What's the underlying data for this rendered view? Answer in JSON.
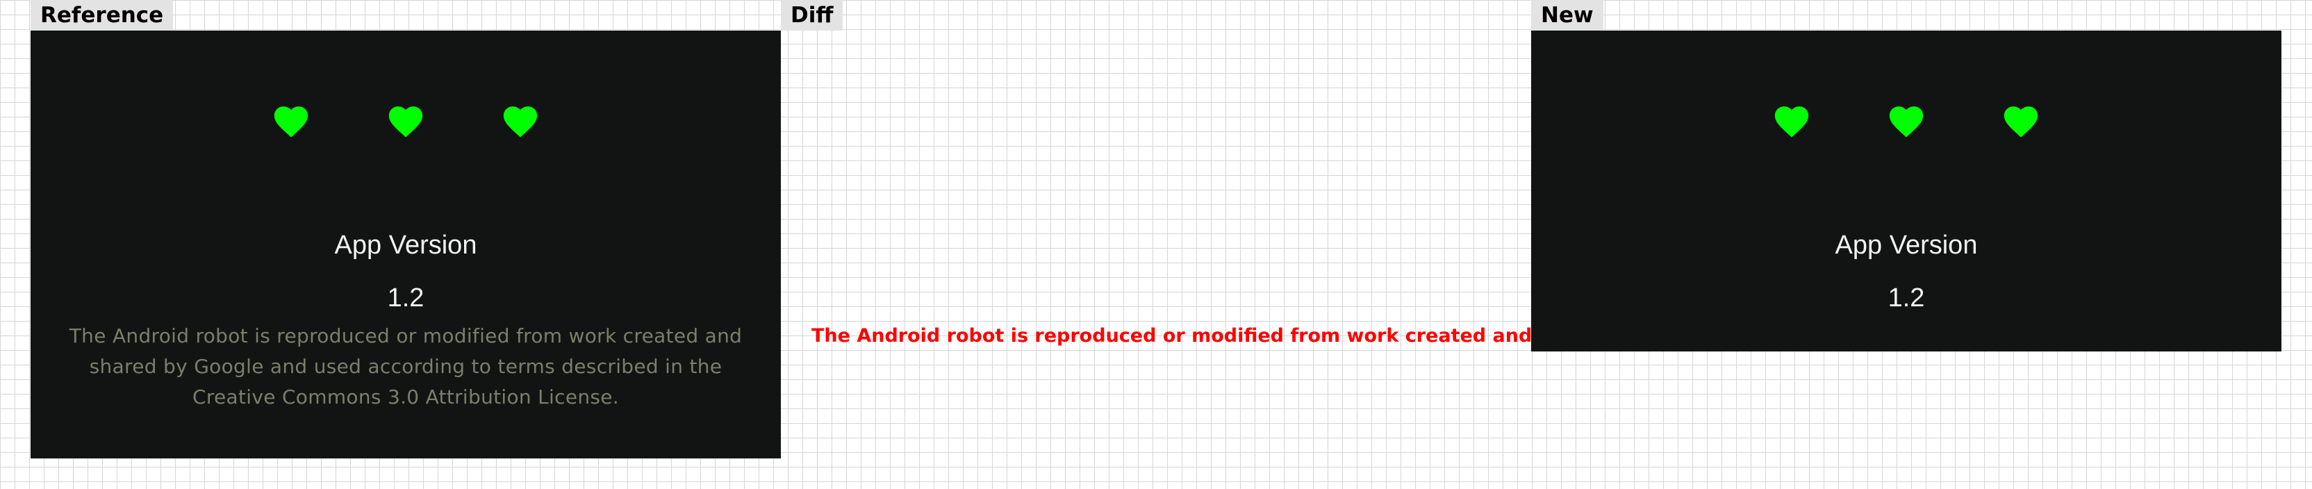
{
  "labels": {
    "reference": "Reference",
    "diff": "Diff",
    "new": "New"
  },
  "icons": {
    "heart": "heart-icon",
    "heart_color": "#00ff00"
  },
  "colors": {
    "screen_background": "#121414",
    "diff_text": "#ff0000",
    "license_text": "#7a7f6a"
  },
  "reference": {
    "app_version_label": "App Version",
    "app_version_value": "1.2",
    "license_lines": [
      "The Android robot is reproduced or modified from work created and",
      "shared by Google and used according to terms described in the",
      "Creative Commons 3.0 Attribution License."
    ]
  },
  "diff": {
    "line": "The Android robot is reproduced or modified from work created and"
  },
  "new": {
    "app_version_label": "App Version",
    "app_version_value": "1.2"
  }
}
